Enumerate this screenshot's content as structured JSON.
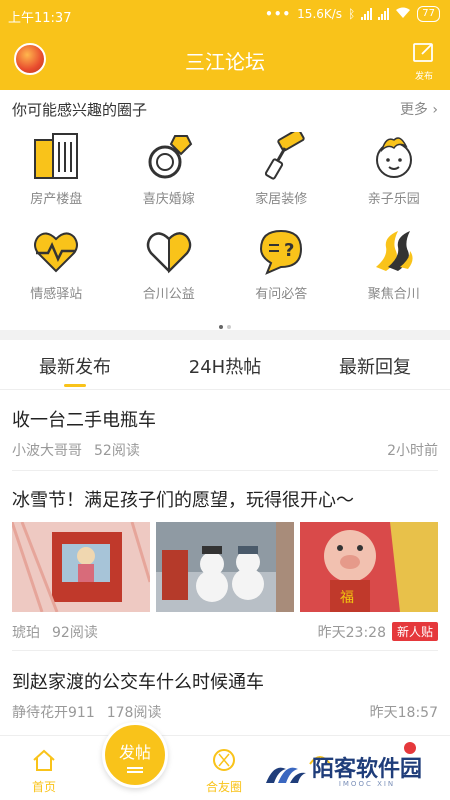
{
  "status_bar": {
    "time": "上午11:37",
    "dots": "•••",
    "network_speed": "15.6K/s",
    "battery": "77"
  },
  "header": {
    "title": "三江论坛",
    "post_label": "发布"
  },
  "circles": {
    "title": "你可能感兴趣的圈子",
    "more": "更多",
    "items": [
      {
        "label": "房产楼盘",
        "icon": "building-icon"
      },
      {
        "label": "喜庆婚嫁",
        "icon": "ring-icon"
      },
      {
        "label": "家居装修",
        "icon": "paint-roller-icon"
      },
      {
        "label": "亲子乐园",
        "icon": "baby-icon"
      },
      {
        "label": "情感驿站",
        "icon": "heartbeat-icon"
      },
      {
        "label": "合川公益",
        "icon": "heart-hands-icon"
      },
      {
        "label": "有问必答",
        "icon": "question-bubble-icon"
      },
      {
        "label": "聚焦合川",
        "icon": "wave-logo-icon"
      }
    ],
    "pager": {
      "pages": 2,
      "current": 1
    }
  },
  "tabs": [
    {
      "label": "最新发布",
      "active": true
    },
    {
      "label": "24H热帖",
      "active": false
    },
    {
      "label": "最新回复",
      "active": false
    }
  ],
  "posts": [
    {
      "title": "收一台二手电瓶车",
      "author": "小波大哥哥",
      "reads": "52阅读",
      "time": "2小时前"
    },
    {
      "title": "冰雪节！满足孩子们的愿望，玩得很开心～",
      "author": "琥珀",
      "reads": "92阅读",
      "time": "昨天23:28",
      "tag": "新人贴"
    },
    {
      "title": "到赵家渡的公交车什么时候通车",
      "author": "静待花开911",
      "reads": "178阅读",
      "time": "昨天18:57"
    }
  ],
  "bottom_nav": {
    "home": "首页",
    "fab": "发帖",
    "friends": "合友圈"
  },
  "watermark": {
    "text": "陌客软件园",
    "sub": "IMOOC XIN"
  },
  "colors": {
    "brand": "#f9c31a",
    "icon_dark": "#333333",
    "badge_red": "#e5383b"
  }
}
